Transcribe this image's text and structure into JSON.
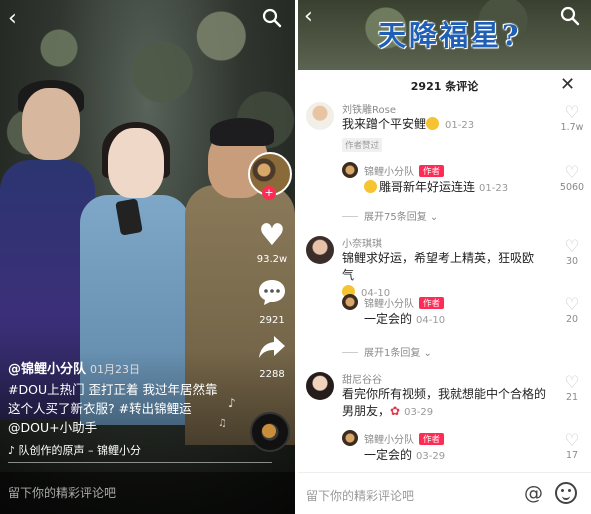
{
  "video": {
    "author": "@锦鲤小分队",
    "date": "01月23日",
    "caption": "#DOU上热门 歪打正着 我过年居然靠这个人买了新衣服? #转出锦鲤运 @DOU+小助手",
    "sound": "♪ 队创作的原声 – 锦鲤小分",
    "likes": "93.2w",
    "comments": "2921",
    "shares": "2288",
    "comment_placeholder": "留下你的精彩评论吧"
  },
  "overlay_title": "天降福星?",
  "comments_sheet": {
    "title": "2921 条评论",
    "input_placeholder": "留下你的精彩评论吧",
    "items": [
      {
        "user": "刘铁雕Rose",
        "text": "我来蹭个平安鲤",
        "time": "01-23",
        "tag": "作者赞过",
        "likes": "1.7w",
        "reply": {
          "user": "锦鲤小分队",
          "badge": "作者",
          "text": "雕哥新年好运连连",
          "time": "01-23",
          "likes": "5060"
        },
        "expand": "展开75条回复"
      },
      {
        "user": "小奈琪琪",
        "text": "锦鲤求好运，希望考上精英，狂吸欧气",
        "time": "04-10",
        "likes": "30",
        "reply": {
          "user": "锦鲤小分队",
          "badge": "作者",
          "text": "一定会的",
          "time": "04-10",
          "likes": "20"
        },
        "expand": "展开1条回复"
      },
      {
        "user": "甜尼谷谷",
        "text": "看完你所有视频，我就想能中个合格的男朋友，",
        "time": "03-29",
        "likes": "21",
        "reply": {
          "user": "锦鲤小分队",
          "badge": "作者",
          "text": "一定会的",
          "time": "03-29",
          "likes": "17"
        }
      }
    ]
  },
  "icons": [
    "back-icon",
    "search-icon",
    "heart-icon",
    "comment-icon",
    "share-icon",
    "close-icon",
    "at-icon",
    "emoji-icon",
    "music-note-icon"
  ],
  "colors": {
    "accent": "#fe2c55",
    "overlay_title": "#1f5fb5"
  }
}
